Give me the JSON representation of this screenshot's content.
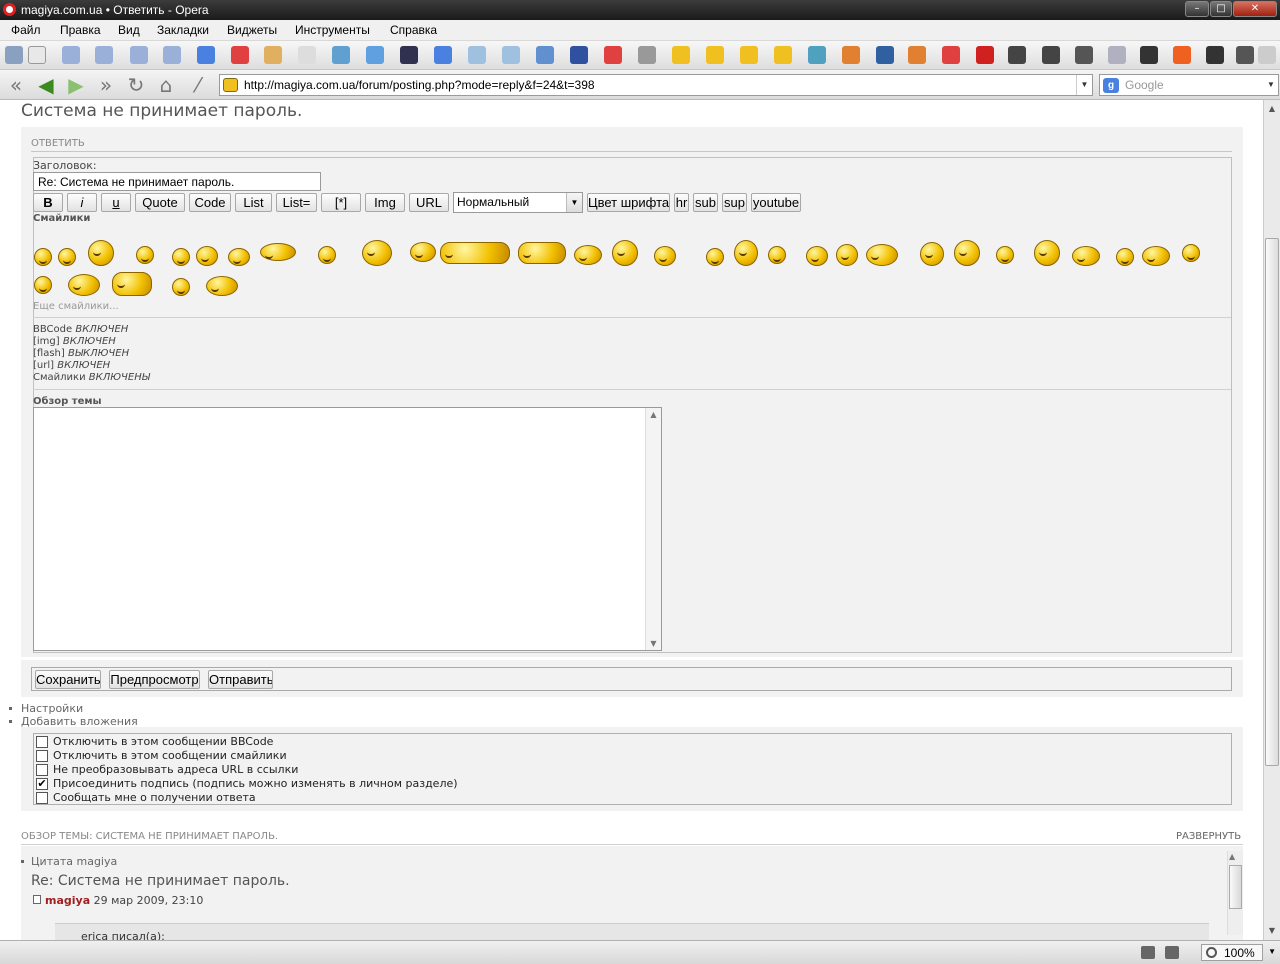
{
  "window": {
    "title": "magiya.com.ua • Ответить - Opera"
  },
  "menu": [
    "Файл",
    "Правка",
    "Вид",
    "Закладки",
    "Виджеты",
    "Инструменты",
    "Справка"
  ],
  "address": {
    "url": "http://magiya.com.ua/forum/posting.php?mode=reply&f=24&t=398",
    "search_placeholder": "Google"
  },
  "page": {
    "topic_title": "Система не принимает пароль.",
    "reply_caption": "ОТВЕТИТЬ",
    "subject_label": "Заголовок:",
    "subject_value": "Re: Система не принимает пароль.",
    "bbcode_buttons": [
      "B",
      "i",
      "u",
      "Quote",
      "Code",
      "List",
      "List=",
      "[*]",
      "Img",
      "URL"
    ],
    "font_size_value": "Нормальный",
    "extra_buttons": [
      "Цвет шрифта",
      "hr",
      "sub",
      "sup",
      "youtube"
    ],
    "smilies_label": "Смайлики",
    "more_smilies": "Еще смайлики...",
    "status": {
      "bbcode_label": "BBCode",
      "bbcode_value": "ВКЛЮЧЕН",
      "img_label": "[img]",
      "img_value": "ВКЛЮЧЕН",
      "flash_label": "[flash]",
      "flash_value": "ВЫКЛЮЧЕН",
      "url_label": "[url]",
      "url_value": "ВКЛЮЧЕН",
      "smilies_label": "Смайлики",
      "smilies_value": "ВКЛЮЧЕНЫ"
    },
    "review_label": "Обзор темы",
    "actions": {
      "save": "Сохранить",
      "preview": "Предпросмотр",
      "submit": "Отправить"
    },
    "links": {
      "settings": "Настройки",
      "attachments": "Добавить вложения"
    },
    "options": [
      {
        "label": "Отключить в этом сообщении BBCode",
        "checked": false
      },
      {
        "label": "Отключить в этом сообщении смайлики",
        "checked": false
      },
      {
        "label": "Не преобразовывать адреса URL в ссылки",
        "checked": false
      },
      {
        "label": "Присоединить подпись (подпись можно изменять в личном разделе)",
        "checked": true
      },
      {
        "label": "Сообщать мне о получении ответа",
        "checked": false
      }
    ],
    "topic_review_heading": "ОБЗОР ТЕМЫ: СИСТЕМА НЕ ПРИНИМАЕТ ПАРОЛЬ.",
    "expand_link": "РАЗВЕРНУТЬ",
    "post": {
      "quote_link": "Цитата magiya",
      "title": "Re: Система не принимает пароль.",
      "author": "magiya",
      "date": "29 мар 2009, 23:10",
      "quote_author": "erica писал(а):"
    }
  },
  "zoom": "100%"
}
